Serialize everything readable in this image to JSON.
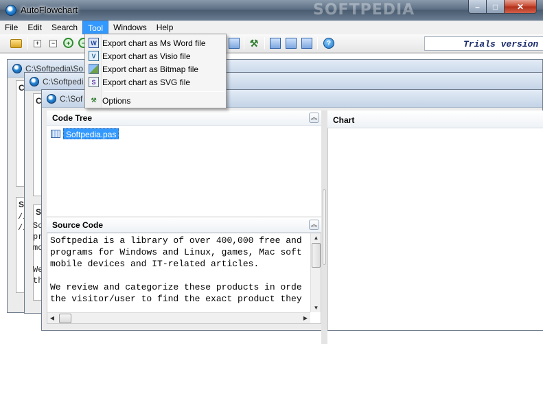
{
  "window": {
    "title": "AutoFlowchart",
    "watermark": "SOFTPEDIA",
    "controls": {
      "minimize": "–",
      "maximize": "□",
      "close": "✕"
    }
  },
  "menubar": {
    "items": [
      {
        "label": "File"
      },
      {
        "label": "Edit"
      },
      {
        "label": "Search"
      },
      {
        "label": "Tool"
      },
      {
        "label": "Windows"
      },
      {
        "label": "Help"
      }
    ]
  },
  "toolbar": {
    "trial_text": "Trials version",
    "zoom_in": "+",
    "zoom_out": "−",
    "expand": "+",
    "collapse": "−",
    "help": "?",
    "tools": "⚒"
  },
  "tool_menu": {
    "items": [
      {
        "label": "Export chart as Ms Word file",
        "icon": "word-icon",
        "glyph": "W"
      },
      {
        "label": "Export chart as Visio file",
        "icon": "visio-icon",
        "glyph": "V"
      },
      {
        "label": "Export chart as Bitmap file",
        "icon": "bitmap-icon",
        "glyph": ""
      },
      {
        "label": "Export chart as SVG file",
        "icon": "svg-icon",
        "glyph": "S"
      },
      {
        "label": "Options",
        "icon": "tools-icon",
        "glyph": "⚒"
      }
    ]
  },
  "mdi_windows": [
    {
      "title": "C:\\Softpedia\\So"
    },
    {
      "title": "C:\\Softpedi"
    },
    {
      "title": "C:\\Sof"
    }
  ],
  "background_fragments": {
    "w1_header_a": "C",
    "w1_header_b": "S",
    "w1_code": "//\n//",
    "w2_header_a": "C",
    "w2_header_b": "S",
    "w2_code": "So\npr\nmo\n\nWe\nth"
  },
  "active_child": {
    "code_tree_title": "Code Tree",
    "tree_file": "Softpedia.pas",
    "source_title": "Source Code",
    "source_lines": [
      "Softpedia is a library of over 400,000 free and",
      "programs for Windows and Linux, games, Mac soft",
      "mobile devices and IT-related articles.",
      "",
      "We review and categorize these products in orde",
      "the visitor/user to find the exact product they"
    ],
    "chart_title": "Chart",
    "collapse_glyph": "︽"
  }
}
